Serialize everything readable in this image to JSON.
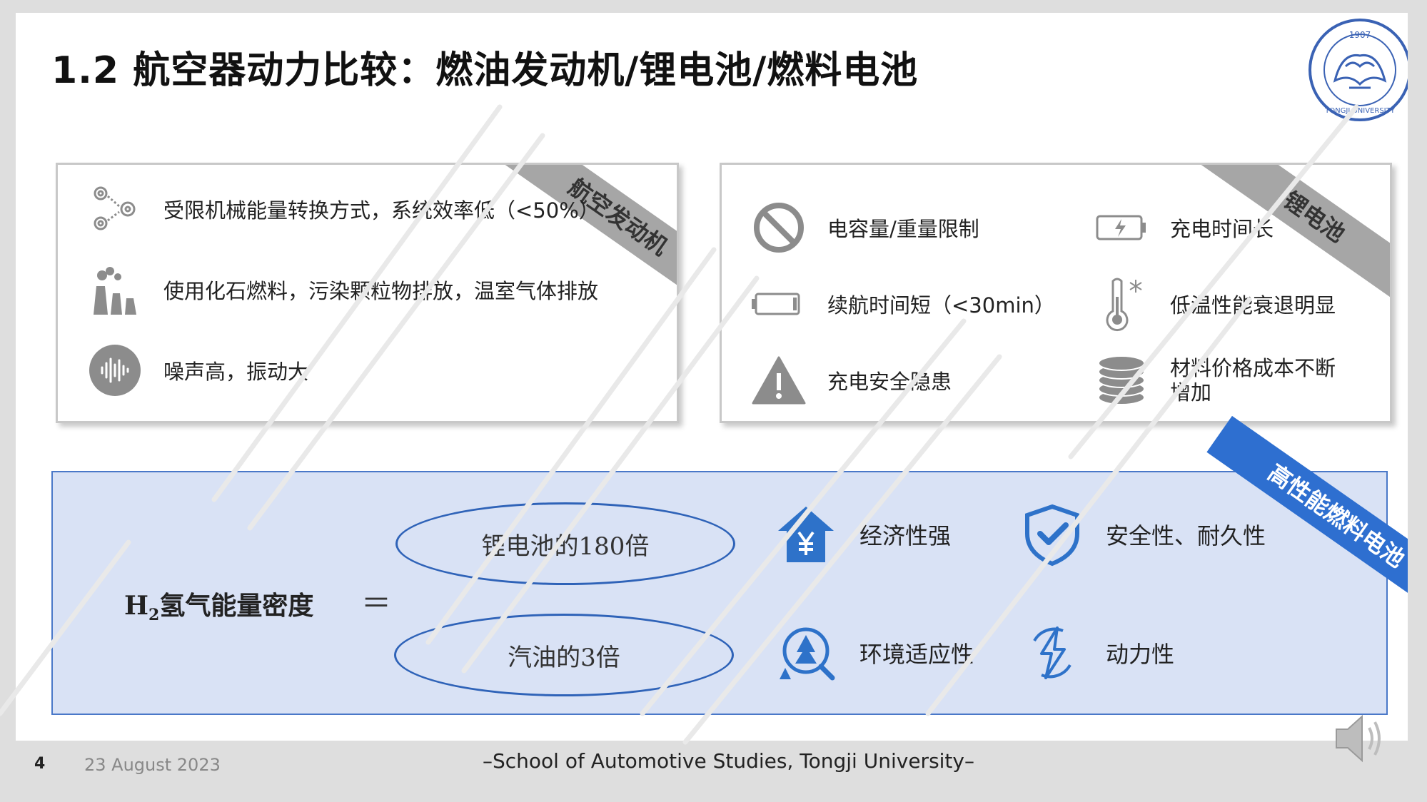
{
  "slide": {
    "title": "1.2 航空器动力比较：燃油发动机/锂电池/燃料电池",
    "logo": {
      "icon": "tongji-university-seal",
      "year": "1907",
      "text": "TONGJI UNIVERSITY"
    }
  },
  "engine_panel": {
    "label": "航空发动机",
    "items": [
      {
        "icon": "gears-icon",
        "text": "受限机械能量转换方式，系统效率低（<50%）"
      },
      {
        "icon": "factory-emission-icon",
        "text": "使用化石燃料，污染颗粒物排放，温室气体排放"
      },
      {
        "icon": "sound-wave-icon",
        "text": "噪声高，振动大"
      }
    ]
  },
  "battery_panel": {
    "label": "锂电池",
    "items": [
      {
        "icon": "prohibited-icon",
        "text": "电容量/重量限制"
      },
      {
        "icon": "charging-battery-icon",
        "text": "充电时间长"
      },
      {
        "icon": "low-battery-icon",
        "text": "续航时间短（<30min）"
      },
      {
        "icon": "thermometer-snow-icon",
        "text": "低温性能衰退明显"
      },
      {
        "icon": "warning-icon",
        "text": "充电安全隐患"
      },
      {
        "icon": "coin-stack-icon",
        "text": "材料价格成本不断增加"
      }
    ]
  },
  "fuel_cell_panel": {
    "label": "高性能燃料电池",
    "h2_prefix": "H",
    "h2_sub": "2",
    "h2_label": "氢气能量密度",
    "equals": "＝",
    "comparisons": [
      "锂电池的180倍",
      "汽油的3倍"
    ],
    "features": [
      {
        "icon": "economy-house-icon",
        "text": "经济性强"
      },
      {
        "icon": "shield-check-icon",
        "text": "安全性、耐久性"
      },
      {
        "icon": "environment-tree-icon",
        "text": "环境适应性"
      },
      {
        "icon": "power-bolt-icon",
        "text": "动力性"
      }
    ]
  },
  "footer": {
    "page_number": "4",
    "date": "23 August 2023",
    "center": "–School of Automotive Studies, Tongji University–"
  },
  "colors": {
    "ribbon_gray": "#a6a6a6",
    "ribbon_blue": "#2e6fd0",
    "box_fill": "#d9e2f5",
    "box_border": "#4a78c8",
    "icon_gray": "#8c8c8c",
    "icon_blue": "#2e72c9"
  }
}
